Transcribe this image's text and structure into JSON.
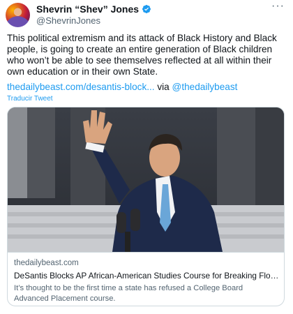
{
  "author": {
    "display_name": "Shevrin “Shev” Jones",
    "handle": "@ShevrinJones",
    "verified_icon": "verified-badge-icon",
    "more_icon": "more-horizontal-icon"
  },
  "tweet": {
    "text": "This political extremism and its attack of Black History and Black people, is going to create an entire generation of Black children who won’t be able to see themselves reflected at all within their own education or in their own State.",
    "link_text": "thedailybeast.com/desantis-block...",
    "via_text": "via",
    "mention": "@thedailybeast",
    "translate_label": "Traducir Tweet"
  },
  "card": {
    "image_desc": "photo-speaker-waving-at-podium",
    "domain": "thedailybeast.com",
    "title": "DeSantis Blocks AP African-American Studies Course for Breaking Florida’s A...",
    "description": "It’s thought to be the first time a state has refused a College Board Advanced Placement course."
  },
  "colors": {
    "link": "#1d9bf0",
    "secondary_text": "#536471",
    "border": "#cfd9de"
  }
}
